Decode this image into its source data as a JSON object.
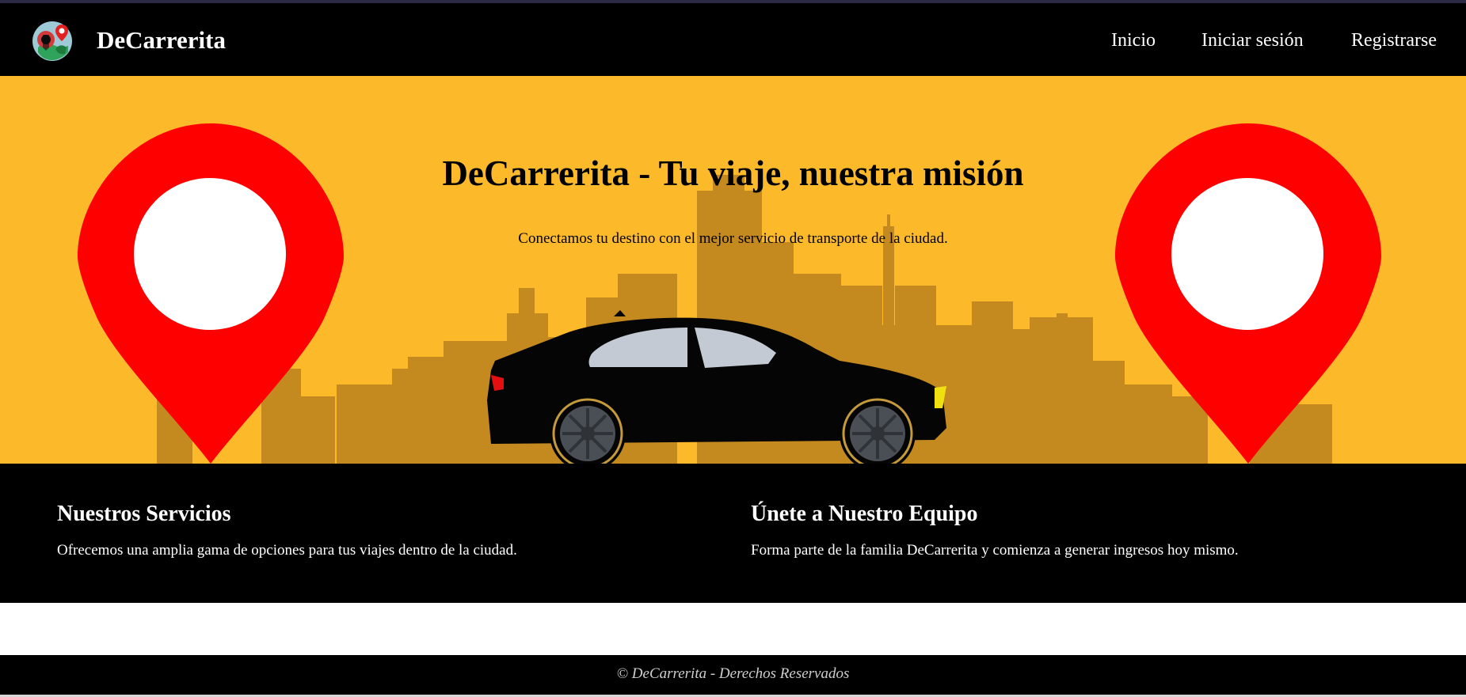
{
  "navbar": {
    "brand": "DeCarrerita",
    "links": {
      "inicio": "Inicio",
      "login": "Iniciar sesión",
      "register": "Registrarse"
    },
    "logo_icon": "map-pin-logo-icon"
  },
  "hero": {
    "title": "DeCarrerita - Tu viaje, nuestra misión",
    "subtitle": "Conectamos tu destino con el mejor servicio de transporte de la ciudad.",
    "background_color": "#fcb92a",
    "pin_color": "#ff0000",
    "skyline_color": "#c48a20"
  },
  "features": {
    "services": {
      "heading": "Nuestros Servicios",
      "text": "Ofrecemos una amplia gama de opciones para tus viajes dentro de la ciudad."
    },
    "team": {
      "heading": "Únete a Nuestro Equipo",
      "text": "Forma parte de la familia DeCarrerita y comienza a generar ingresos hoy mismo."
    }
  },
  "footer": {
    "text": "© DeCarrerita - Derechos Reservados"
  }
}
